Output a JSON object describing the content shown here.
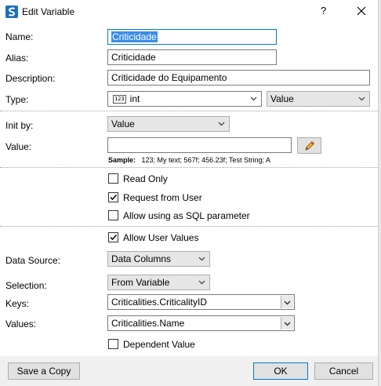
{
  "window": {
    "title": "Edit Variable",
    "help_glyph": "?",
    "close_glyph": "✕",
    "app_icon": "app-logo-icon"
  },
  "fields": {
    "name_label": "Name:",
    "name_value": "Criticidade",
    "alias_label": "Alias:",
    "alias_value": "Criticidade",
    "description_label": "Description:",
    "description_value": "Criticidade do Equipamento",
    "type_label": "Type:",
    "type_value": "int",
    "type_icon_text": "123",
    "type_kind": "Value",
    "initby_label": "Init by:",
    "initby_value": "Value",
    "value_label": "Value:",
    "value_value": "",
    "sample_label": "Sample:",
    "sample_text": "123; My text; 567f; 456.23f; Test String; A"
  },
  "options": {
    "read_only": "Read Only",
    "read_only_checked": false,
    "request_from_user": "Request from User",
    "request_from_user_checked": true,
    "allow_sql": "Allow using as SQL parameter",
    "allow_sql_checked": false,
    "allow_user_values": "Allow User Values",
    "allow_user_values_checked": true,
    "dependent_value": "Dependent Value",
    "dependent_value_checked": false
  },
  "datasource": {
    "data_source_label": "Data Source:",
    "data_source_value": "Data Columns",
    "selection_label": "Selection:",
    "selection_value": "From Variable",
    "keys_label": "Keys:",
    "keys_value": "Criticalities.CriticalityID",
    "values_label": "Values:",
    "values_value": "Criticalities.Name"
  },
  "footer": {
    "save_copy": "Save a Copy",
    "ok": "OK",
    "cancel": "Cancel"
  },
  "colors": {
    "accent": "#0078d7",
    "selection": "#3a8ee6"
  }
}
